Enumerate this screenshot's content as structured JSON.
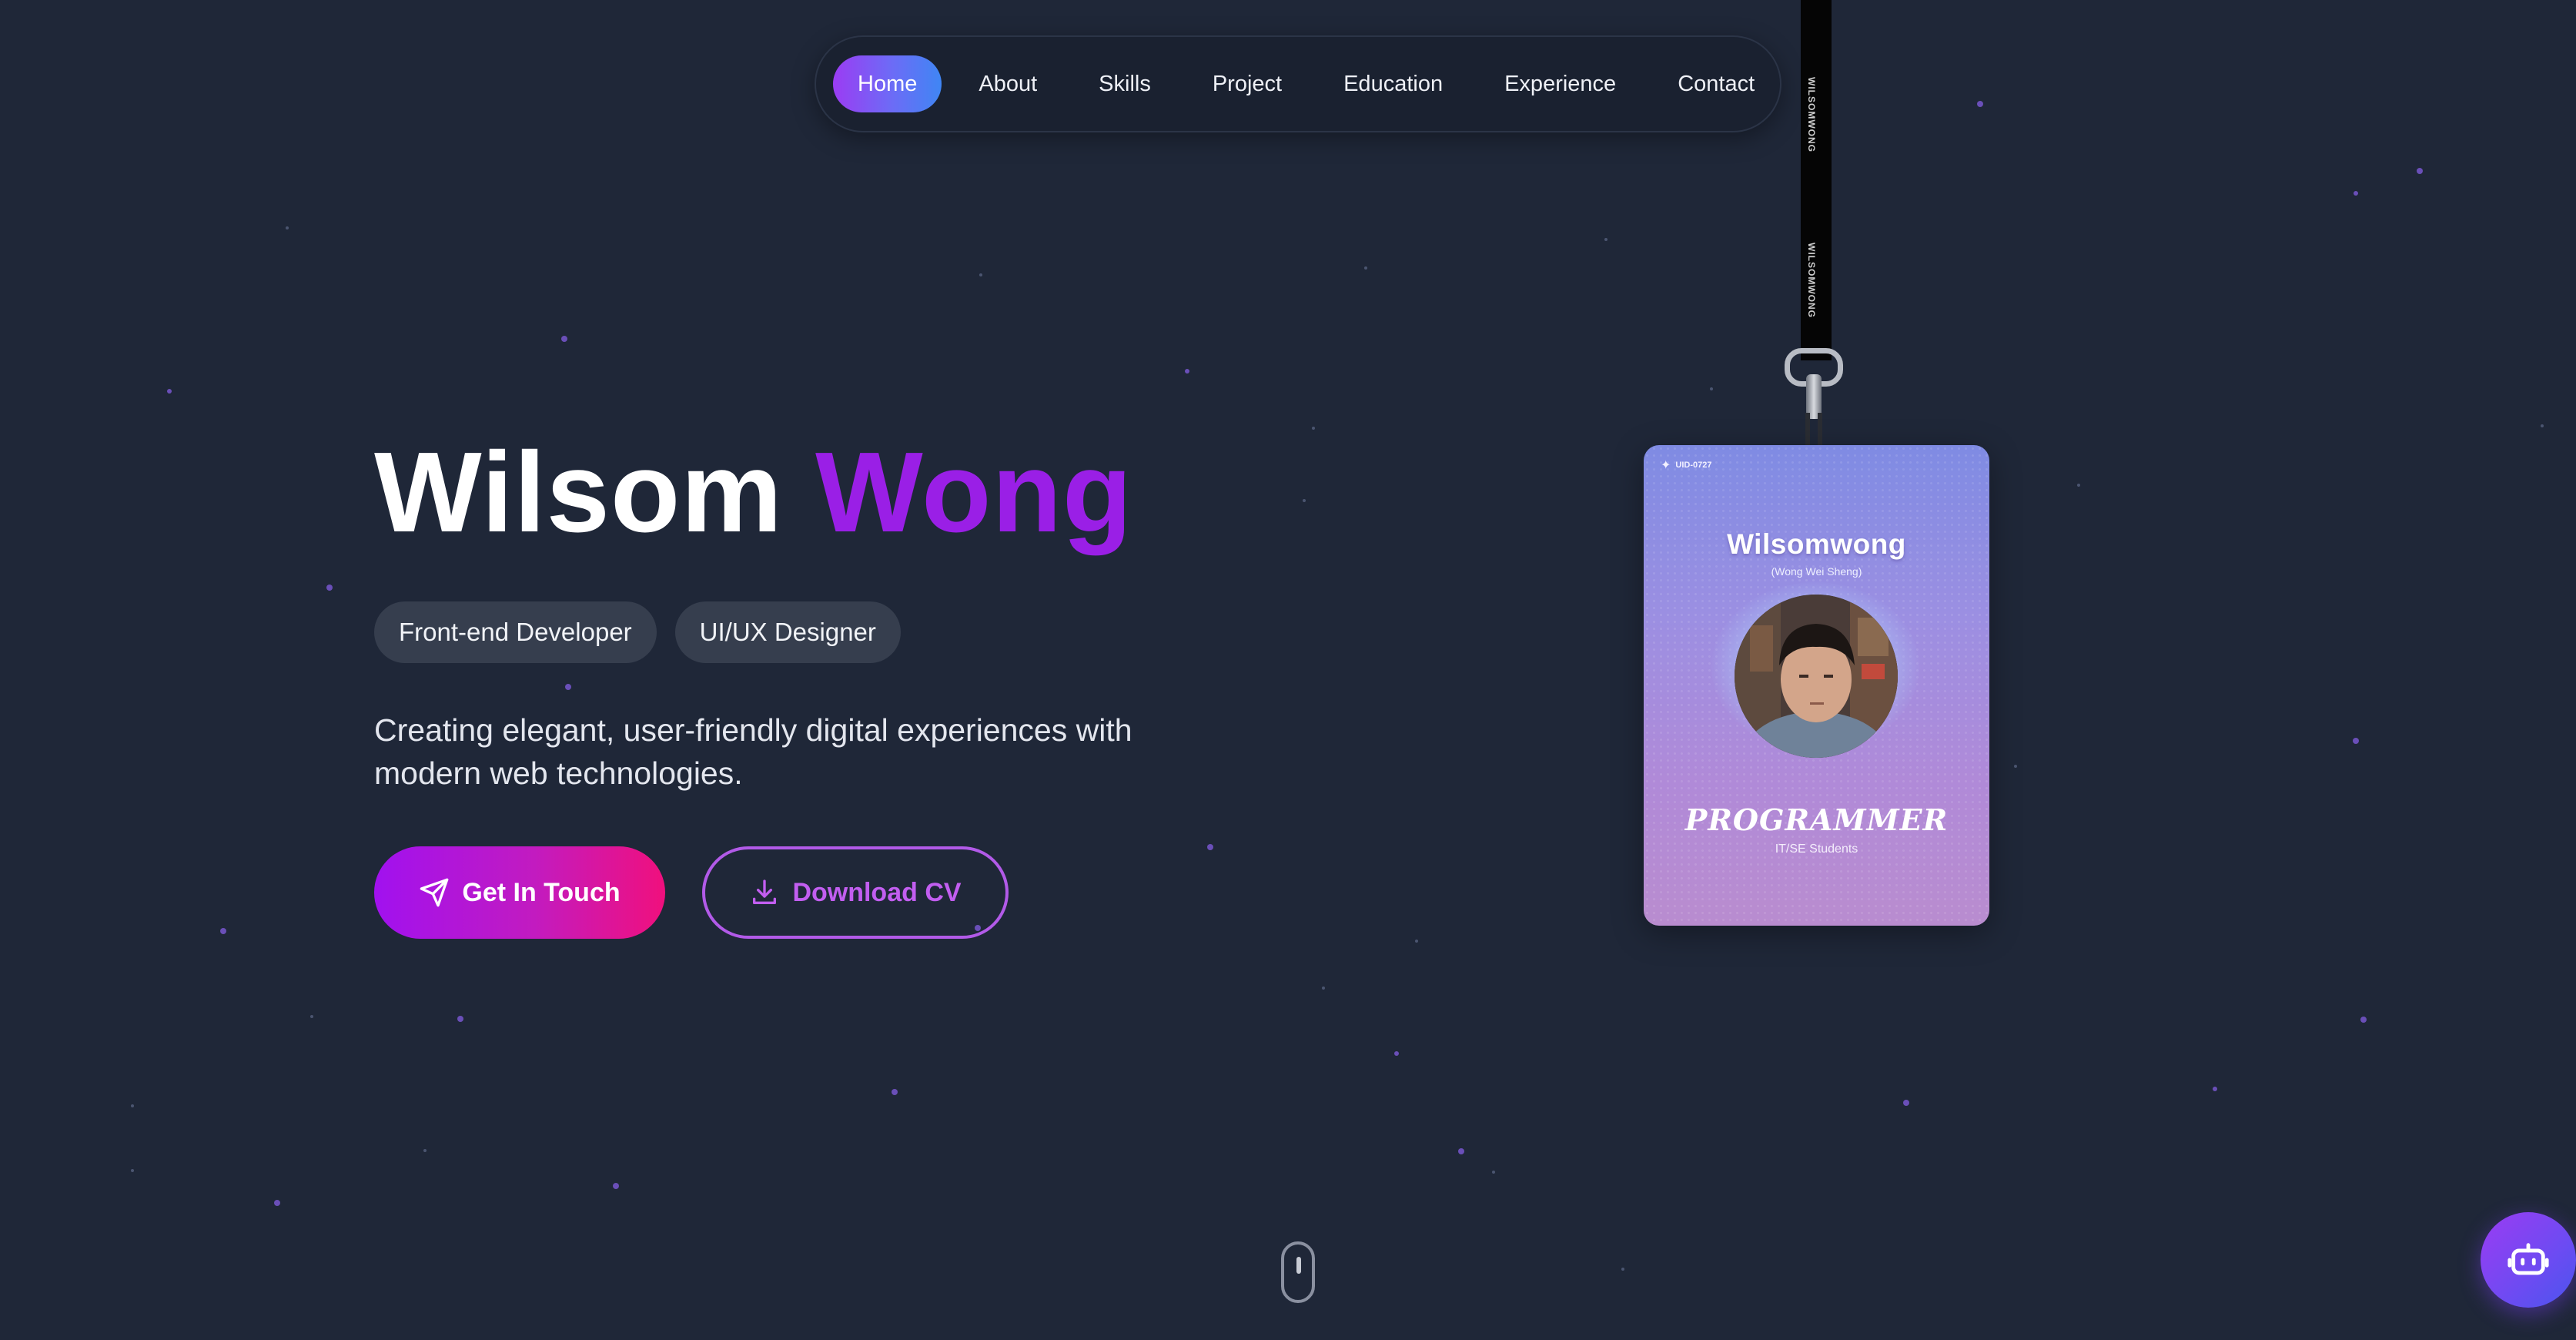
{
  "nav": {
    "items": [
      {
        "label": "Home",
        "active": true
      },
      {
        "label": "About",
        "active": false
      },
      {
        "label": "Skills",
        "active": false
      },
      {
        "label": "Project",
        "active": false
      },
      {
        "label": "Education",
        "active": false
      },
      {
        "label": "Experience",
        "active": false
      },
      {
        "label": "Contact",
        "active": false
      }
    ]
  },
  "hero": {
    "first_name": "Wilsom",
    "last_name": "Wong",
    "tags": [
      "Front-end Developer",
      "UI/UX Designer"
    ],
    "tagline_line1": "Creating elegant, user-friendly digital experiences with",
    "tagline_line2": "modern web technologies.",
    "primary_button": "Get In Touch",
    "secondary_button": "Download CV"
  },
  "lanyard": {
    "strap_text": "WILSOMWONG",
    "badge": {
      "id": "UID-0727",
      "name": "Wilsomwong",
      "subname": "(Wong Wei Sheng)",
      "role": "PROGRAMMER",
      "role_sub": "IT/SE Students"
    }
  },
  "icons": {
    "send": "send-icon",
    "download": "download-icon",
    "bot": "robot-icon",
    "scroll": "mouse-scroll-icon"
  },
  "colors": {
    "background": "#1f2738",
    "accent_purple": "#9a1fe6",
    "accent_pink": "#f0107d",
    "nav_active_start": "#9b3cf3",
    "nav_active_end": "#3f86f4"
  }
}
